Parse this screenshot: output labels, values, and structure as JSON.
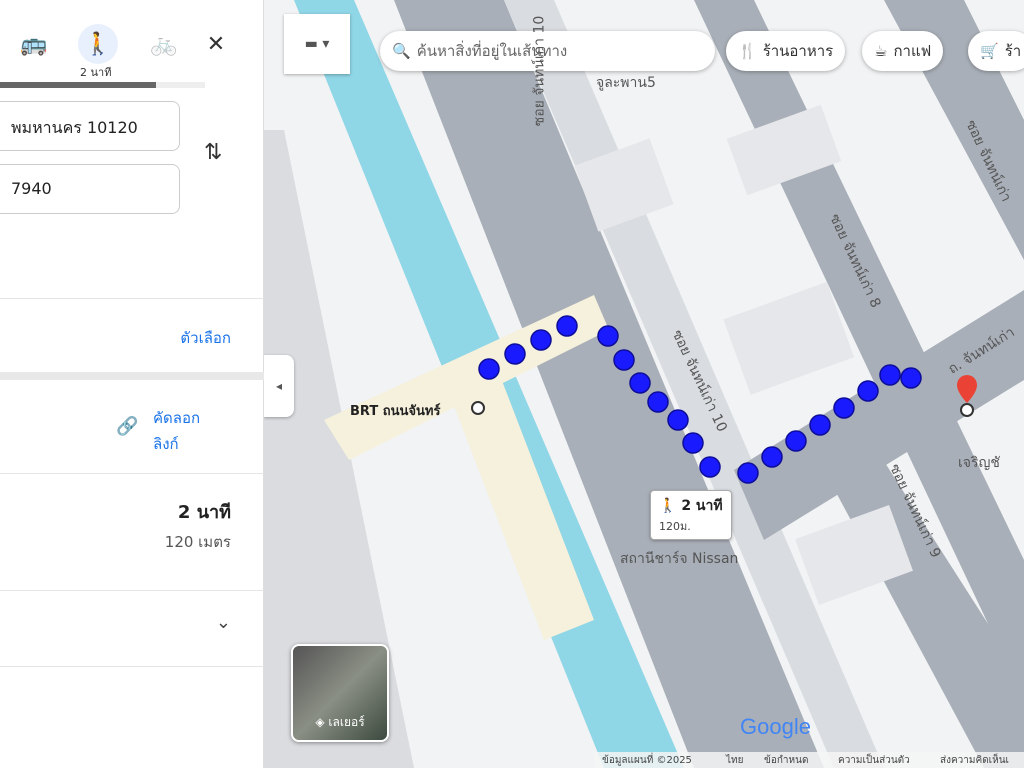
{
  "panel": {
    "modes": [
      {
        "icon": "bus-icon",
        "glyph": "🚌"
      },
      {
        "icon": "walk-icon",
        "glyph": "🚶",
        "sub": "2 นาที"
      },
      {
        "icon": "bicycle-icon",
        "glyph": "🚲",
        "sub": "—"
      }
    ],
    "close_glyph": "✕",
    "origin": "พมหานคร 10120",
    "destination": "7940",
    "swap_glyph": "⇅",
    "options_label": "ตัวเลือก",
    "copy_link_label": [
      "คัดลอก",
      "ลิงก์"
    ],
    "route": {
      "time": "2 นาที",
      "distance": "120 เมตร"
    },
    "expand_glyph": "⌄",
    "collapse_glyph": "◂"
  },
  "map": {
    "search_placeholder": "ค้นหาสิ่งที่อยู่ในเส้นทาง",
    "chips": [
      {
        "icon": "restaurant-icon",
        "glyph": "🍴",
        "label": "ร้านอาหาร"
      },
      {
        "icon": "coffee-icon",
        "glyph": "☕",
        "label": "กาแฟ"
      },
      {
        "icon": "cart-icon",
        "glyph": "🛒",
        "label": "ร้า"
      }
    ],
    "labels": {
      "origin_stop": "BRT ถนนจันทร์",
      "poi1": "จูละพาน5",
      "poi2": "เจริญชั",
      "ev": "สถานีชาร์จ Nissan",
      "soi10": "ซอย จันทน์เก่า 10",
      "soi10b": "ซอย จันทน์เก่า 10",
      "soi8": "ซอย จันทน์เก่า 8",
      "soi9": "ซอย จันทน์เก่า 9",
      "road": "ถ. จันทน์เก่า",
      "soi_top": "ซอย จันทน์เก่า"
    },
    "callout": {
      "time": "2 นาที",
      "distance": "120ม."
    },
    "layers_label": "เลเยอร์",
    "logo": "Google",
    "footer": [
      "ข้อมูลแผนที่ ©2025",
      "ไทย",
      "ข้อกำหนด",
      "ความเป็นส่วนตัว",
      "ส่งความคิดเห็นเ"
    ],
    "route_color": "#1a1aff"
  }
}
